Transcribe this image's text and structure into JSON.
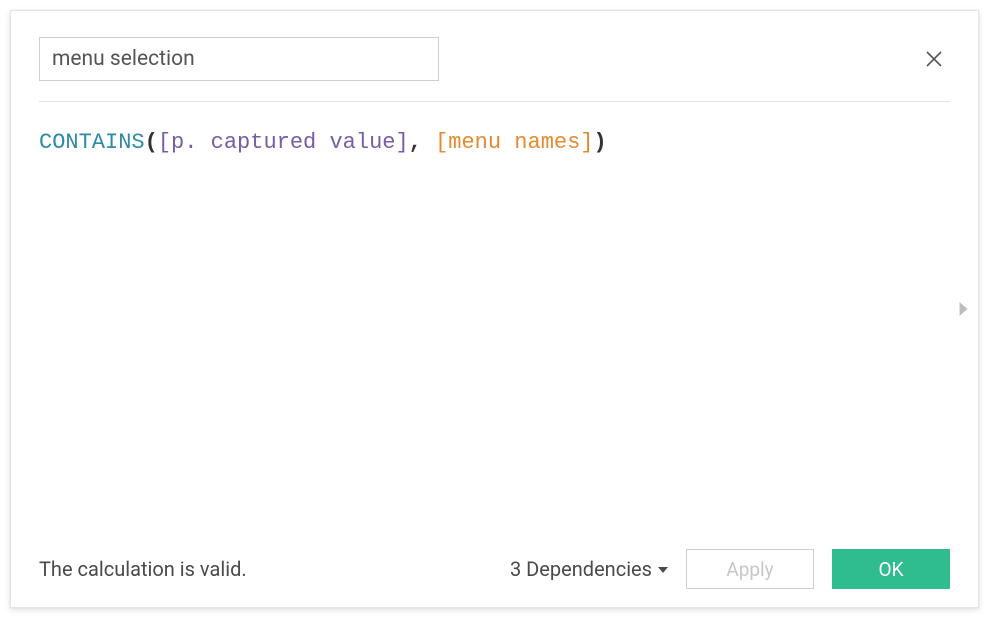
{
  "header": {
    "title_value": "menu selection"
  },
  "formula": {
    "fn": "CONTAINS",
    "open": "(",
    "field1": "[p. captured value]",
    "sep": ", ",
    "field2": "[menu names]",
    "close": ")"
  },
  "footer": {
    "status": "The calculation is valid.",
    "dependencies_label": "3 Dependencies",
    "apply_label": "Apply",
    "ok_label": "OK"
  },
  "icons": {
    "close": "close-icon",
    "expand": "chevron-right-icon",
    "caret": "caret-down-icon"
  }
}
